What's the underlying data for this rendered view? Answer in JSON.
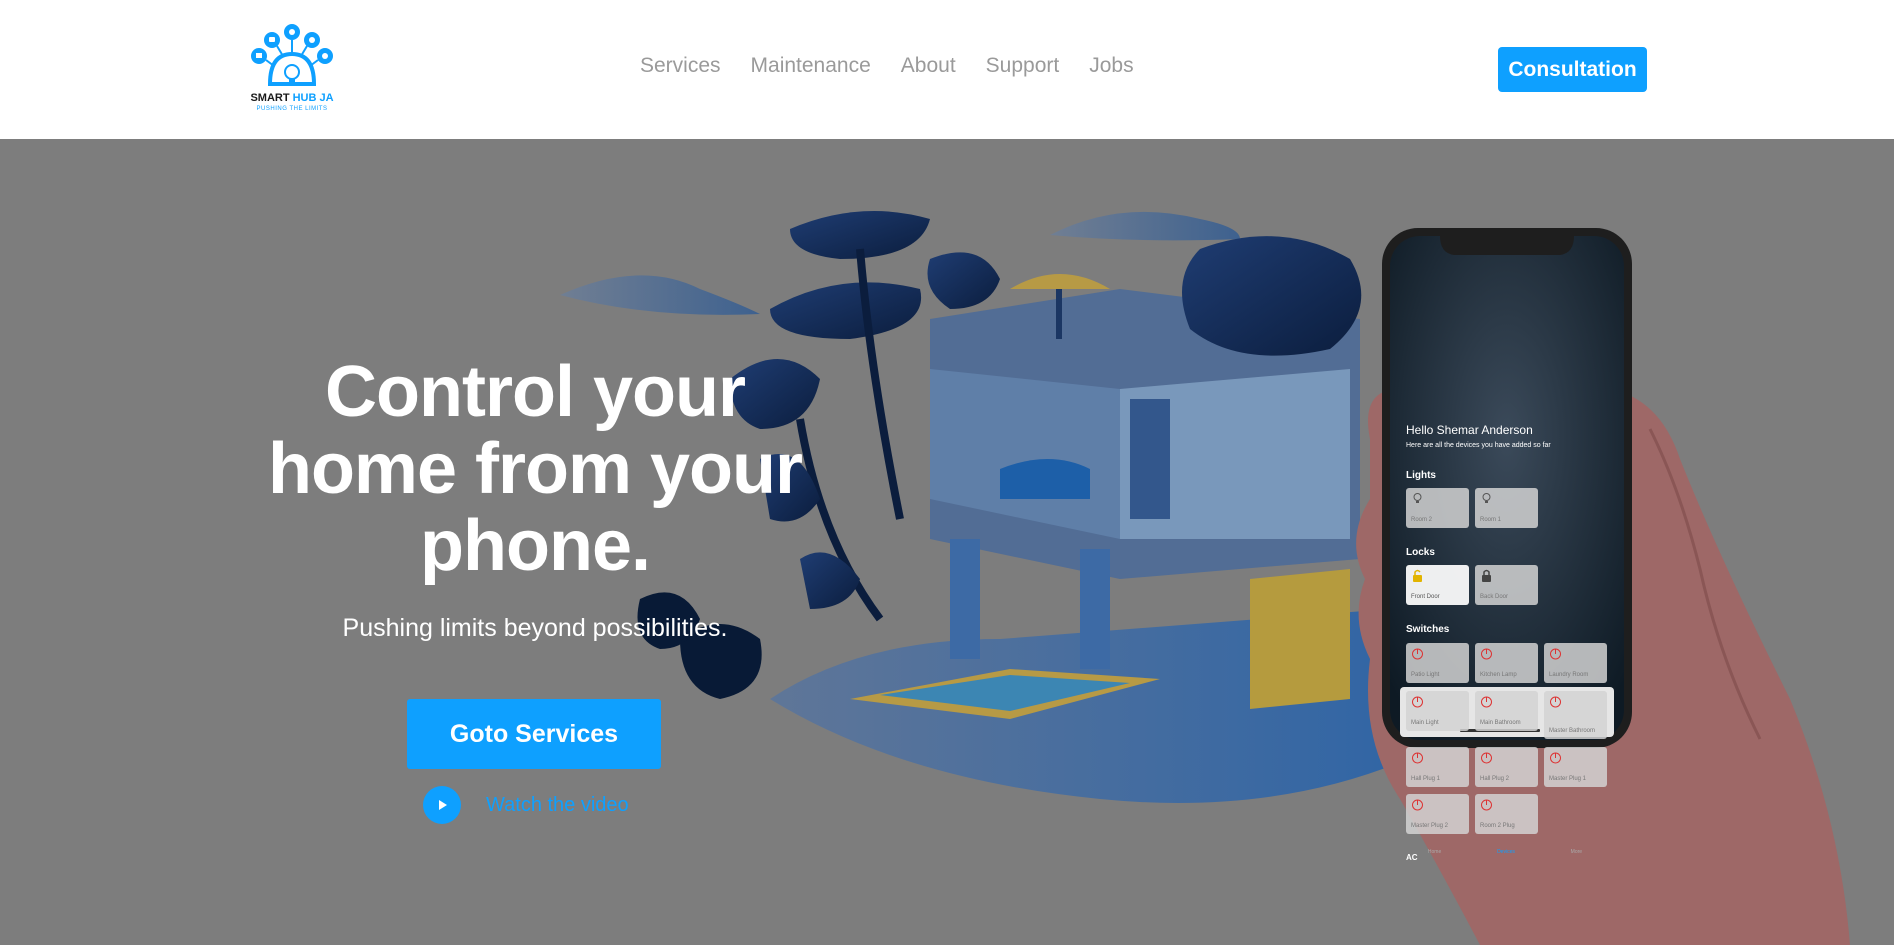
{
  "header": {
    "brand_main": "SMART",
    "brand_accent": "HUB JA",
    "tagline": "PUSHING THE LIMITS",
    "nav": [
      "Services",
      "Maintenance",
      "About",
      "Support",
      "Jobs"
    ],
    "cta": "Consultation"
  },
  "hero": {
    "title_line1": "Control your",
    "title_line2": "home from your",
    "title_line3": "phone.",
    "subtitle": "Pushing limits beyond possibilities.",
    "primary_button": "Goto Services",
    "video_link": "Watch the video"
  },
  "phone": {
    "greeting": "Hello Shemar Anderson",
    "greeting_sub": "Here are all the devices you have added so far",
    "sections": {
      "lights": "Lights",
      "locks": "Locks",
      "switches": "Switches"
    },
    "lights": [
      "Room 2",
      "Room 1"
    ],
    "locks": [
      "Front Door",
      "Back Door"
    ],
    "switches": [
      "Patio Light",
      "Kitchen Lamp",
      "Laundry Room",
      "Main Light",
      "Main Bathroom",
      "Master Bathroom",
      "Hall Plug 1",
      "Hall Plug 2",
      "Master Plug 1",
      "Master Plug 2",
      "Room 2 Plug"
    ],
    "tabs": [
      "Home",
      "Devices",
      "More"
    ],
    "footer_label": "AC"
  },
  "colors": {
    "accent": "#0ea0ff",
    "hero_bg": "#7d7d7d",
    "nav_text": "#9a9a9a"
  }
}
